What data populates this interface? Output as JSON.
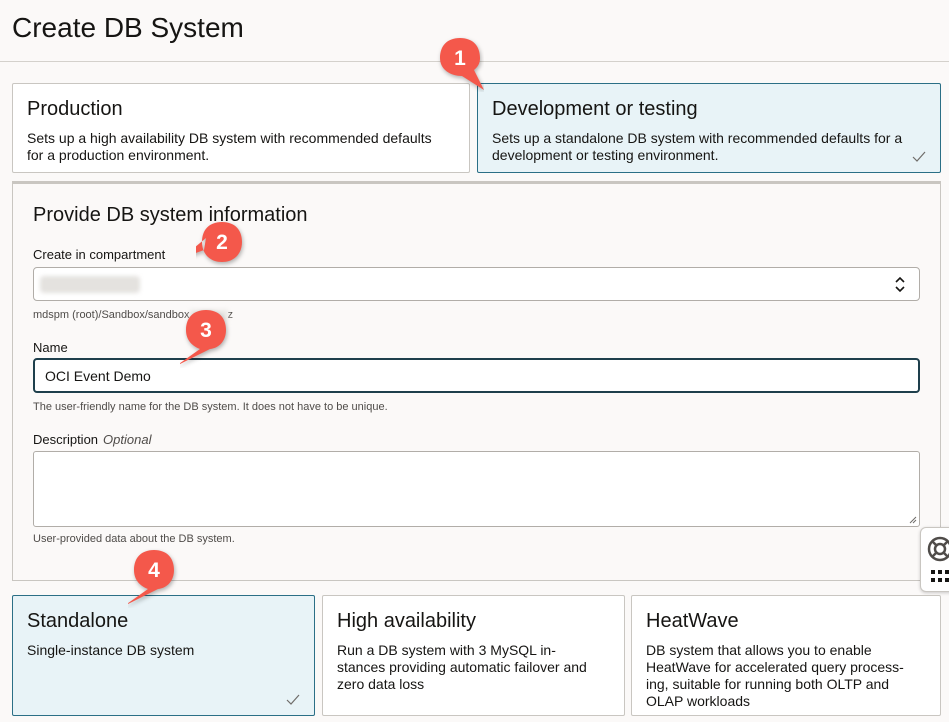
{
  "page": {
    "title": "Create DB System"
  },
  "config_options": [
    {
      "title": "Production",
      "description": "Sets up a high availability DB system with recommended defaults for a production environment.",
      "selected": false
    },
    {
      "title": "Development or testing",
      "description": "Sets up a standalone DB system with recommended defaults for a development or testing environment.",
      "selected": true
    }
  ],
  "form": {
    "section_title": "Provide DB system information",
    "compartment": {
      "label": "Create in compartment",
      "path": "mdspm (root)/Sandbox/sandbox",
      "path_suffix": "z"
    },
    "name": {
      "label": "Name",
      "value": "OCI Event Demo",
      "hint": "The user-friendly name for the DB system. It does not have to be unique."
    },
    "description": {
      "label": "Description",
      "optional_label": "Optional",
      "value": "",
      "hint": "User-provided data about the DB system."
    }
  },
  "system_types": [
    {
      "title": "Standalone",
      "description": "Single-instance DB system",
      "selected": true
    },
    {
      "title": "High availability",
      "description": "Run a DB system with 3 MySQL in-stances providing automatic failover and zero data loss",
      "selected": false
    },
    {
      "title": "HeatWave",
      "description": "DB system that allows you to enable HeatWave for accelerated query process-ing, suitable for running both OLTP and OLAP workloads",
      "selected": false
    }
  ],
  "callouts": [
    "1",
    "2",
    "3",
    "4"
  ],
  "colors": {
    "accent": "#2b6f86",
    "selected_bg": "#e8f3f7",
    "callout": "#f4584b"
  }
}
